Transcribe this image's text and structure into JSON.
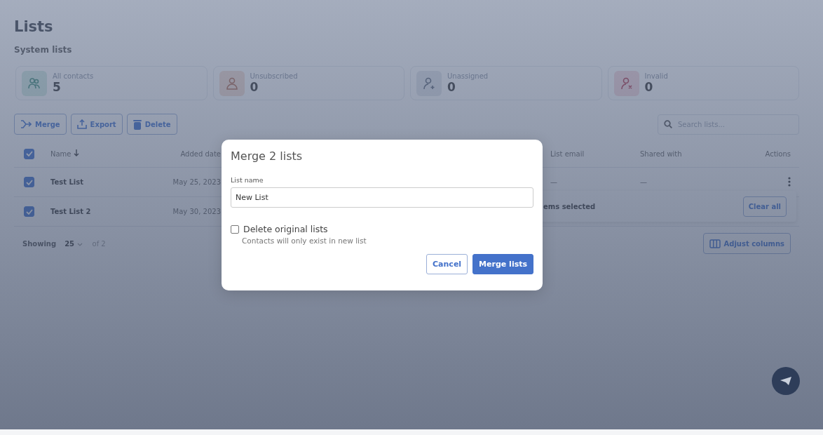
{
  "page": {
    "title": "Lists",
    "subtitle": "System lists"
  },
  "stats": [
    {
      "label": "All contacts",
      "value": "5",
      "kind": "group"
    },
    {
      "label": "Unsubscribed",
      "value": "0",
      "kind": "person"
    },
    {
      "label": "Unassigned",
      "value": "0",
      "kind": "person-plus"
    },
    {
      "label": "Invalid",
      "value": "0",
      "kind": "person-x"
    }
  ],
  "toolbar": [
    {
      "label": "Merge",
      "kind": "merge"
    },
    {
      "label": "Export",
      "kind": "export"
    },
    {
      "label": "Delete",
      "kind": "delete"
    }
  ],
  "search": {
    "placeholder": "Search lists..."
  },
  "table": {
    "header_checked": true,
    "columns": [
      {
        "label": "Name",
        "sorted": true
      },
      {
        "label": "Added date",
        "sorted": false
      },
      {
        "label": "List email",
        "sorted": false
      },
      {
        "label": "Shared with",
        "sorted": false
      },
      {
        "label": "Actions",
        "sorted": false
      }
    ],
    "rows": [
      {
        "selected": true,
        "name": "Test List",
        "added_date": "May 25, 2023",
        "list_email": "—",
        "shared_with": "—",
        "menu": true
      },
      {
        "selected": true,
        "name": "Test List 2",
        "added_date": "May 30, 2023"
      }
    ]
  },
  "selection_bar": {
    "text": "ems selected",
    "button": "Clear all"
  },
  "footer": {
    "showing_label": "Showing",
    "page_size": "25",
    "of_total": "of 2",
    "adjust_button": "Adjust columns"
  },
  "dialog": {
    "title": "Merge 2 lists",
    "field_label": "List name",
    "field_value": "New List",
    "checkbox": {
      "label": "Delete original lists",
      "checked": false,
      "hint": "Contacts will only exist in new list"
    },
    "buttons": [
      {
        "label": "Cancel",
        "kind": "secondary"
      },
      {
        "label": "Merge lists",
        "kind": "primary"
      }
    ]
  }
}
